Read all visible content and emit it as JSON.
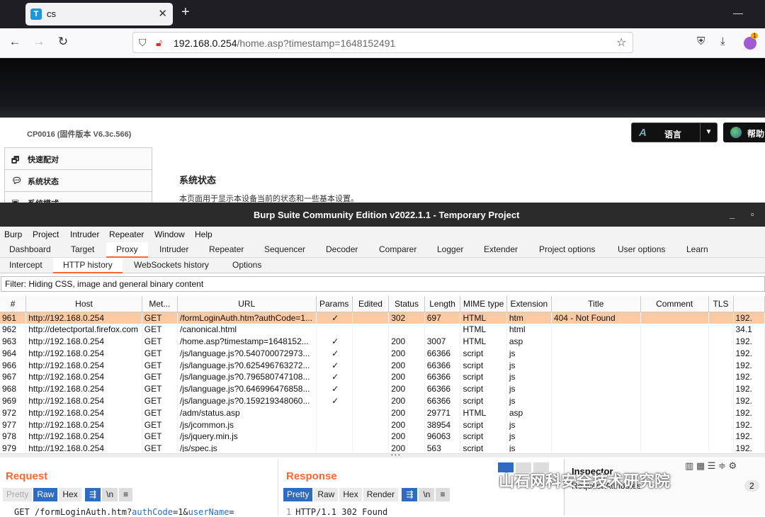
{
  "browser": {
    "tab_title": "cs",
    "tab_favicon_letter": "T",
    "url_host": "192.168.0.254",
    "url_path": "/home.asp?timestamp=1648152491",
    "extension_badge": "1"
  },
  "router": {
    "firmware": "CP0016 (固件版本 V6.3c.566)",
    "language_button": "语言",
    "help_button": "帮助",
    "menu": [
      "快速配对",
      "系统状态",
      "系统模式"
    ],
    "status_title": "系统状态",
    "status_desc": "本页面用于显示本设备当前的状态和一些基本设置。"
  },
  "burp": {
    "title": "Burp Suite Community Edition v2022.1.1 - Temporary Project",
    "menu": [
      "Burp",
      "Project",
      "Intruder",
      "Repeater",
      "Window",
      "Help"
    ],
    "main_tabs": [
      "Dashboard",
      "Target",
      "Proxy",
      "Intruder",
      "Repeater",
      "Sequencer",
      "Decoder",
      "Comparer",
      "Logger",
      "Extender",
      "Project options",
      "User options",
      "Learn"
    ],
    "sub_tabs": [
      "Intercept",
      "HTTP history",
      "WebSockets history",
      "Options"
    ],
    "filter": "Filter: Hiding CSS, image and general binary content",
    "columns": [
      "#",
      "Host",
      "Met...",
      "URL",
      "Params",
      "Edited",
      "Status",
      "Length",
      "MIME type",
      "Extension",
      "Title",
      "Comment",
      "TLS",
      ""
    ],
    "rows": [
      [
        "961",
        "http://192.168.0.254",
        "GET",
        "/formLoginAuth.htm?authCode=1...",
        "✓",
        "",
        "302",
        "697",
        "HTML",
        "htm",
        "404 - Not Found",
        "",
        "",
        "192."
      ],
      [
        "962",
        "http://detectportal.firefox.com",
        "GET",
        "/canonical.html",
        "",
        "",
        "",
        "",
        "HTML",
        "html",
        "",
        "",
        "",
        "34.1"
      ],
      [
        "963",
        "http://192.168.0.254",
        "GET",
        "/home.asp?timestamp=1648152...",
        "✓",
        "",
        "200",
        "3007",
        "HTML",
        "asp",
        "",
        "",
        "",
        "192."
      ],
      [
        "964",
        "http://192.168.0.254",
        "GET",
        "/js/language.js?0.540700072973...",
        "✓",
        "",
        "200",
        "66366",
        "script",
        "js",
        "",
        "",
        "",
        "192."
      ],
      [
        "966",
        "http://192.168.0.254",
        "GET",
        "/js/language.js?0.625496763272...",
        "✓",
        "",
        "200",
        "66366",
        "script",
        "js",
        "",
        "",
        "",
        "192."
      ],
      [
        "967",
        "http://192.168.0.254",
        "GET",
        "/js/language.js?0.796580747108...",
        "✓",
        "",
        "200",
        "66366",
        "script",
        "js",
        "",
        "",
        "",
        "192."
      ],
      [
        "968",
        "http://192.168.0.254",
        "GET",
        "/js/language.js?0.646996476858...",
        "✓",
        "",
        "200",
        "66366",
        "script",
        "js",
        "",
        "",
        "",
        "192."
      ],
      [
        "969",
        "http://192.168.0.254",
        "GET",
        "/js/language.js?0.159219348060...",
        "✓",
        "",
        "200",
        "66366",
        "script",
        "js",
        "",
        "",
        "",
        "192."
      ],
      [
        "972",
        "http://192.168.0.254",
        "GET",
        "/adm/status.asp",
        "",
        "",
        "200",
        "29771",
        "HTML",
        "asp",
        "",
        "",
        "",
        "192."
      ],
      [
        "977",
        "http://192.168.0.254",
        "GET",
        "/js/jcommon.js",
        "",
        "",
        "200",
        "38954",
        "script",
        "js",
        "",
        "",
        "",
        "192."
      ],
      [
        "978",
        "http://192.168.0.254",
        "GET",
        "/js/jquery.min.js",
        "",
        "",
        "200",
        "96063",
        "script",
        "js",
        "",
        "",
        "",
        "192."
      ],
      [
        "979",
        "http://192.168.0.254",
        "GET",
        "/js/spec.js",
        "",
        "",
        "200",
        "563",
        "script",
        "js",
        "",
        "",
        "",
        "192."
      ]
    ],
    "request": {
      "heading": "Request",
      "buttons": [
        "Pretty",
        "Raw",
        "Hex"
      ],
      "line_prefix": "GET /formLoginAuth.htm?",
      "line_k1": "authCode",
      "line_mid": "=1&",
      "line_k2": "userName",
      "line_end": "="
    },
    "response": {
      "heading": "Response",
      "buttons": [
        "Pretty",
        "Raw",
        "Hex",
        "Render"
      ],
      "line_no": "1",
      "line": "HTTP/1.1 302 Found"
    },
    "newline_label": "\\n",
    "inspector": {
      "title": "Inspector",
      "section": "Request Attributes",
      "count": "2"
    }
  },
  "watermark": "山石网科安全技术研究院"
}
